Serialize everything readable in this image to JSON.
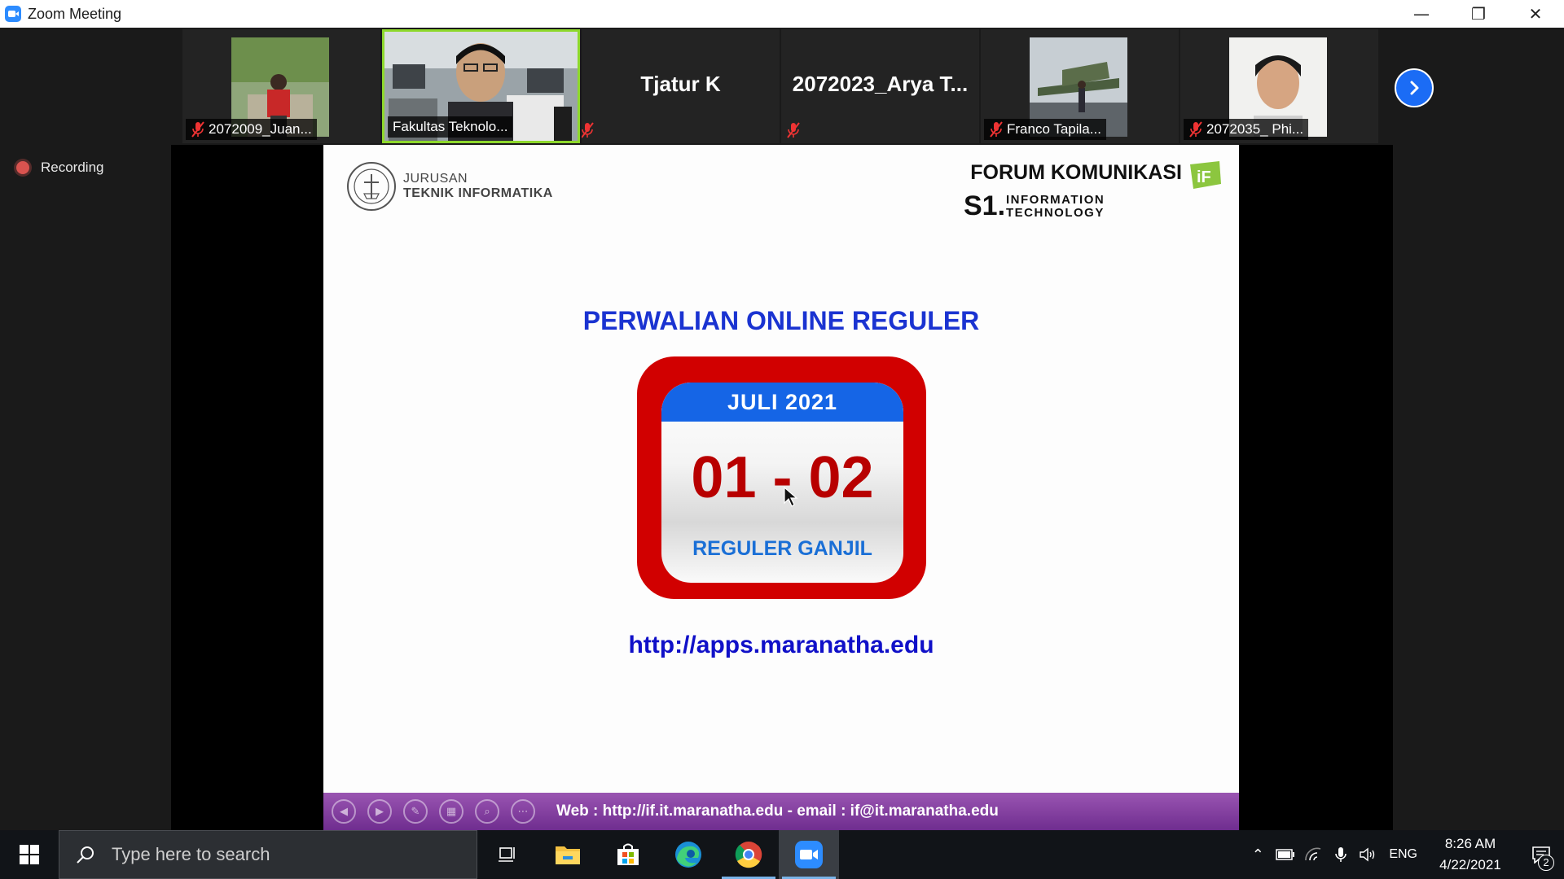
{
  "window": {
    "title": "Zoom Meeting",
    "controls": {
      "minimize": "—",
      "restore": "❐",
      "close": "✕"
    }
  },
  "participants": [
    {
      "name": "2072009_Juan...",
      "muted": true,
      "has_video": true
    },
    {
      "name": "Fakultas Teknolo...",
      "muted": true,
      "has_video": true,
      "active_speaker": true
    },
    {
      "name": "Tjatur K",
      "muted": false,
      "has_video": false
    },
    {
      "name": "2072023_Arya  T...",
      "muted": true,
      "has_video": false
    },
    {
      "name": "Franco Tapila...",
      "muted": true,
      "has_video": true
    },
    {
      "name": "2072035_ Phi...",
      "muted": true,
      "has_video": true
    }
  ],
  "recording": {
    "label": "Recording"
  },
  "slide": {
    "dept_line1": "JURUSAN",
    "dept_line2": "TEKNIK INFORMATIKA",
    "forum_title": "FORUM KOMUNIKASI",
    "forum_sub": "S1.INFORMATION TECHNOLOGY",
    "forum_badge": "iF",
    "headline": "PERWALIAN ONLINE REGULER",
    "calendar_month": "JULI 2021",
    "calendar_dates": "01 - 02",
    "calendar_label": "REGULER GANJIL",
    "url": "http://apps.maranatha.edu",
    "footer": "Web : http://if.it.maranatha.edu - email : if@it.maranatha.edu"
  },
  "taskbar": {
    "search_placeholder": "Type here to search",
    "language": "ENG",
    "time": "8:26 AM",
    "date": "4/22/2021",
    "notification_count": "2"
  },
  "colors": {
    "zoom_blue": "#2d8cff",
    "active_border": "#8ed82c",
    "headline_blue": "#1a33d1",
    "calendar_red": "#d10000",
    "footer_purple": "#7a3a9a"
  }
}
